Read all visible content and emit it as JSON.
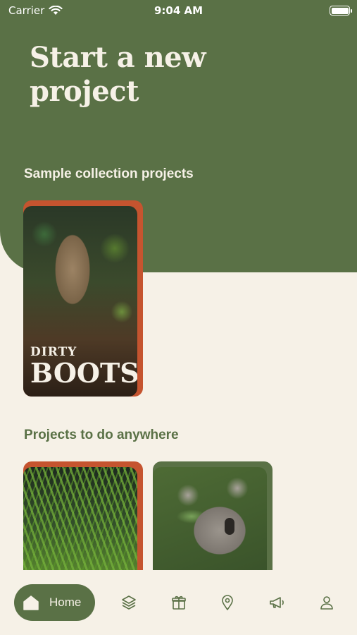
{
  "status_bar": {
    "carrier": "Carrier",
    "time": "9:04 AM"
  },
  "header": {
    "title_line1": "Start a new",
    "title_line2": "project"
  },
  "sections": {
    "sample": {
      "title": "Sample collection projects"
    },
    "anywhere": {
      "title": "Projects to do anywhere"
    }
  },
  "cards": {
    "dirty_boots": {
      "logo_line1": "DIRTY",
      "logo_line2": "BOOTS"
    }
  },
  "nav": {
    "home_label": "Home",
    "icons": [
      "layers-icon",
      "gift-icon",
      "location-pin-icon",
      "megaphone-icon",
      "profile-icon"
    ]
  },
  "colors": {
    "brand_green": "#5a7146",
    "accent_orange": "#c5542f",
    "background_cream": "#f6f1e7"
  }
}
